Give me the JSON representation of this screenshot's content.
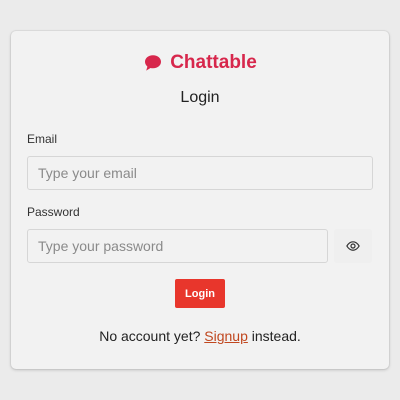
{
  "app": {
    "name": "Chattable",
    "icon": "chat-bubble-icon",
    "brand_color": "#d7274c"
  },
  "form": {
    "title": "Login",
    "email": {
      "label": "Email",
      "value": "",
      "placeholder": "Type your email"
    },
    "password": {
      "label": "Password",
      "value": "",
      "placeholder": "Type your password",
      "toggle_icon": "eye-icon"
    },
    "submit": {
      "label": "Login",
      "color": "#e8362c"
    },
    "footer": {
      "prefix": "No account yet?",
      "link": "Signup",
      "suffix": "instead.",
      "link_color": "#c0471f"
    }
  }
}
